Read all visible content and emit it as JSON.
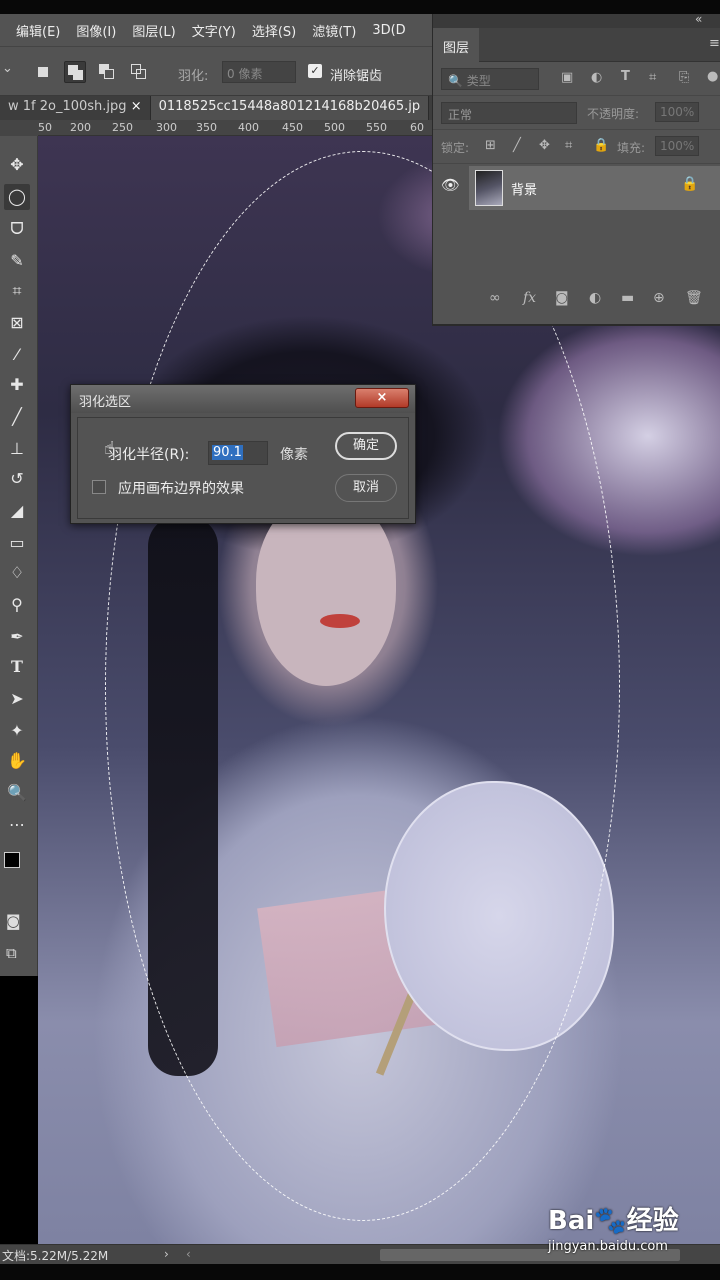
{
  "menubar": {
    "items": [
      "编辑(E)",
      "图像(I)",
      "图层(L)",
      "文字(Y)",
      "选择(S)",
      "滤镜(T)",
      "3D(D"
    ]
  },
  "options": {
    "feather_label": "羽化:",
    "feather_value": "0 像素",
    "antialias_label": "消除锯齿",
    "antialias_checked": true
  },
  "tabs": [
    {
      "label": "w 1f 2o_100sh.jpg",
      "close": "×"
    },
    {
      "label": "0118525cc15448a801214168b20465.jp"
    }
  ],
  "ruler": {
    "ticks": [
      "50",
      "200",
      "250",
      "300",
      "350",
      "400",
      "450",
      "500",
      "550",
      "60"
    ]
  },
  "layers_panel": {
    "title": "图层",
    "collapse_glyph": "«",
    "kind": "类型",
    "blend": "正常",
    "opacity_label": "不透明度:",
    "opacity_value": "100%",
    "lock_label": "锁定:",
    "fill_label": "填充:",
    "fill_value": "100%",
    "layer": {
      "name": "背景",
      "visible": true,
      "locked": true
    }
  },
  "dialog": {
    "title": "羽化选区",
    "close_label": "×",
    "radius_label": "羽化半径(R):",
    "radius_value": "90.1",
    "unit": "像素",
    "apply_canvas_label": "应用画布边界的效果",
    "apply_canvas_checked": false,
    "ok_label": "确定",
    "cancel_label": "取消"
  },
  "status": {
    "doc_size": "文档:5.22M/5.22M",
    "arrow": "›",
    "left": "‹"
  },
  "watermark": {
    "logo": "Bai🐾经验",
    "url": "jingyan.baidu.com"
  }
}
